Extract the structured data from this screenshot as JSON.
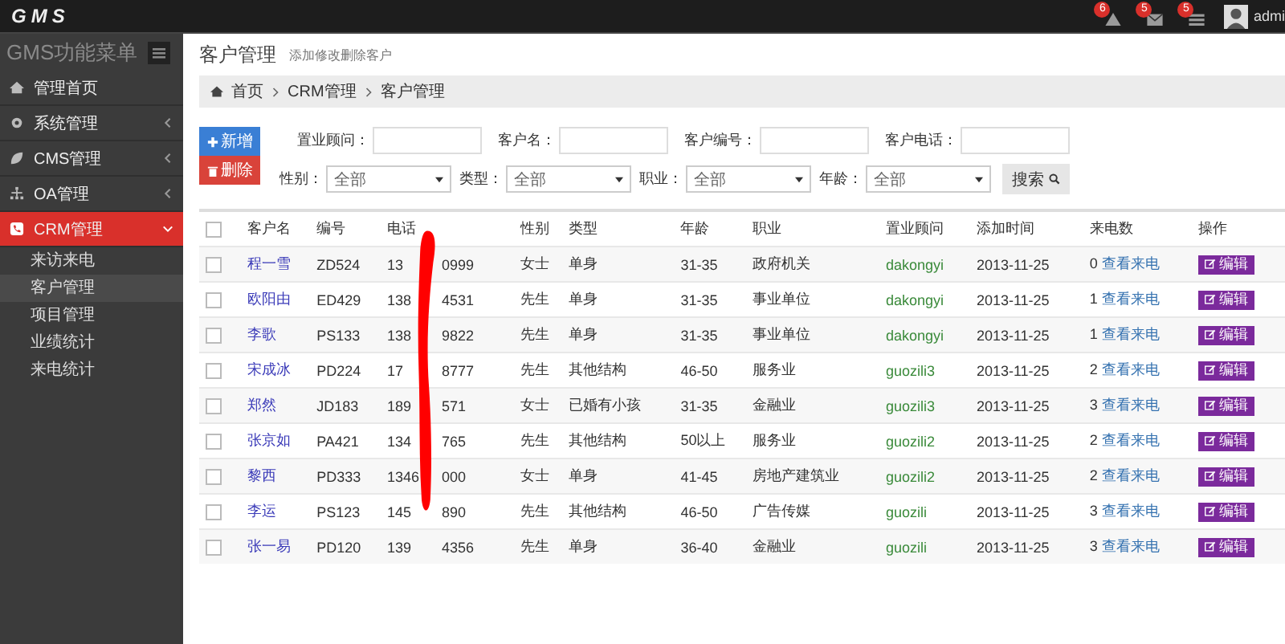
{
  "topbar": {
    "logo": "GMS",
    "notifications": [
      {
        "kind": "alert",
        "count": "6"
      },
      {
        "kind": "mail",
        "count": "5"
      },
      {
        "kind": "list",
        "count": "5"
      }
    ],
    "user": "admi"
  },
  "sidebar": {
    "title": "GMS功能菜单",
    "items": [
      {
        "label": "管理首页",
        "selected": false
      },
      {
        "label": "系统管理",
        "selected": false,
        "expanded": false
      },
      {
        "label": "CMS管理",
        "selected": false,
        "expanded": false
      },
      {
        "label": "OA管理",
        "selected": false,
        "expanded": false
      },
      {
        "label": "CRM管理",
        "selected": true,
        "expanded": true,
        "children": [
          {
            "label": "来访来电",
            "selected": false
          },
          {
            "label": "客户管理",
            "selected": true
          },
          {
            "label": "项目管理",
            "selected": false
          },
          {
            "label": "业绩统计",
            "selected": false
          },
          {
            "label": "来电统计",
            "selected": false
          }
        ]
      }
    ]
  },
  "page": {
    "title": "客户管理",
    "subtitle": "添加修改删除客户"
  },
  "breadcrumb": [
    "首页",
    "CRM管理",
    "客户管理"
  ],
  "actions": [
    {
      "kind": "add",
      "label": "新增"
    },
    {
      "kind": "delete",
      "label": "删除"
    }
  ],
  "filters": [
    [
      {
        "kind": "input",
        "label": "置业顾问："
      },
      {
        "kind": "input",
        "label": "客户名："
      },
      {
        "kind": "input",
        "label": "客户编号："
      },
      {
        "kind": "input",
        "label": "客户电话："
      }
    ],
    [
      {
        "kind": "select",
        "label": "性别：",
        "value": "全部"
      },
      {
        "kind": "select",
        "label": "类型：",
        "value": "全部"
      },
      {
        "kind": "select",
        "label": "职业：",
        "value": "全部"
      },
      {
        "kind": "select",
        "label": "年龄：",
        "value": "全部"
      }
    ]
  ],
  "search_button": "搜索",
  "table": {
    "all_checked": false,
    "columns": [
      "客户名",
      "编号",
      "电话",
      "性别",
      "类型",
      "年龄",
      "职业",
      "置业顾问",
      "添加时间",
      "来电数",
      "操作"
    ],
    "rows": [
      {
        "checked": false,
        "name": "程一雪",
        "code": "ZD524",
        "phone_start": "13",
        "phone_end": "0999",
        "gender": "女士",
        "type": "单身",
        "age": "31-35",
        "job": "政府机关",
        "consultant": "dakongyi",
        "date": "2013-11-25",
        "calls": "0",
        "calls_link": "查看来电",
        "action": "编辑"
      },
      {
        "checked": false,
        "name": "欧阳由",
        "code": "ED429",
        "phone_start": "138",
        "phone_end": "4531",
        "gender": "先生",
        "type": "单身",
        "age": "31-35",
        "job": "事业单位",
        "consultant": "dakongyi",
        "date": "2013-11-25",
        "calls": "1",
        "calls_link": "查看来电",
        "action": "编辑"
      },
      {
        "checked": false,
        "name": "李歌",
        "code": "PS133",
        "phone_start": "138",
        "phone_end": "9822",
        "gender": "先生",
        "type": "单身",
        "age": "31-35",
        "job": "事业单位",
        "consultant": "dakongyi",
        "date": "2013-11-25",
        "calls": "1",
        "calls_link": "查看来电",
        "action": "编辑"
      },
      {
        "checked": false,
        "name": "宋成冰",
        "code": "PD224",
        "phone_start": "17",
        "phone_end": "8777",
        "gender": "先生",
        "type": "其他结构",
        "age": "46-50",
        "job": "服务业",
        "consultant": "guozili3",
        "date": "2013-11-25",
        "calls": "2",
        "calls_link": "查看来电",
        "action": "编辑"
      },
      {
        "checked": false,
        "name": "郑然",
        "code": "JD183",
        "phone_start": "189",
        "phone_end": "571",
        "gender": "女士",
        "type": "已婚有小孩",
        "age": "31-35",
        "job": "金融业",
        "consultant": "guozili3",
        "date": "2013-11-25",
        "calls": "3",
        "calls_link": "查看来电",
        "action": "编辑"
      },
      {
        "checked": false,
        "name": "张京如",
        "code": "PA421",
        "phone_start": "134",
        "phone_end": "765",
        "gender": "先生",
        "type": "其他结构",
        "age": "50以上",
        "job": "服务业",
        "consultant": "guozili2",
        "date": "2013-11-25",
        "calls": "2",
        "calls_link": "查看来电",
        "action": "编辑"
      },
      {
        "checked": false,
        "name": "黎西",
        "code": "PD333",
        "phone_start": "1346",
        "phone_end": "000",
        "gender": "女士",
        "type": "单身",
        "age": "41-45",
        "job": "房地产建筑业",
        "consultant": "guozili2",
        "date": "2013-11-25",
        "calls": "2",
        "calls_link": "查看来电",
        "action": "编辑"
      },
      {
        "checked": false,
        "name": "李运",
        "code": "PS123",
        "phone_start": "145",
        "phone_end": "890",
        "gender": "先生",
        "type": "其他结构",
        "age": "46-50",
        "job": "广告传媒",
        "consultant": "guozili",
        "date": "2013-11-25",
        "calls": "3",
        "calls_link": "查看来电",
        "action": "编辑"
      },
      {
        "checked": false,
        "name": "张一易",
        "code": "PD120",
        "phone_start": "139",
        "phone_end": "4356",
        "gender": "先生",
        "type": "单身",
        "age": "36-40",
        "job": "金融业",
        "consultant": "guozili",
        "date": "2013-11-25",
        "calls": "3",
        "calls_link": "查看来电",
        "action": "编辑"
      }
    ]
  }
}
